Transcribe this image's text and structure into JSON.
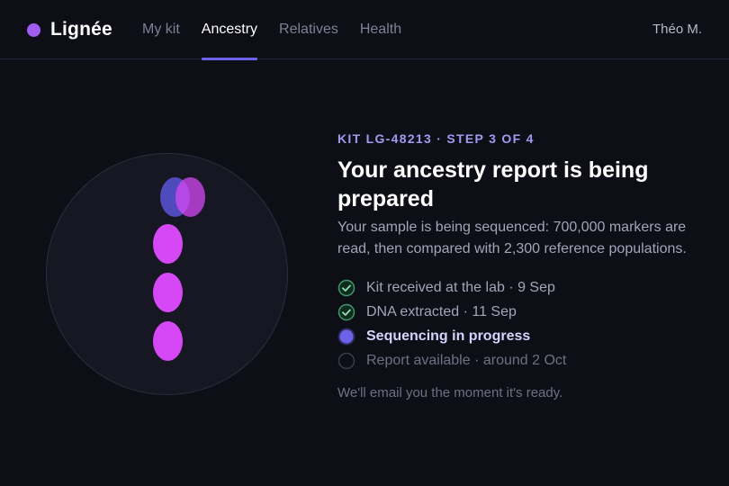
{
  "brand": {
    "name": "Lignée",
    "color": "#a15cf0"
  },
  "nav": {
    "tabs": [
      {
        "label": "My kit",
        "active": false
      },
      {
        "label": "Ancestry",
        "active": true
      },
      {
        "label": "Relatives",
        "active": false
      },
      {
        "label": "Health",
        "active": false
      }
    ],
    "user": "Théo M."
  },
  "status": {
    "eyebrow": "KIT LG-48213 · STEP 3 OF 4",
    "title": "Your ancestry report is being prepared",
    "description": "Your sample is being sequenced: 700,000 markers are read, then compared with 2,300 reference populations.",
    "steps": [
      {
        "label": "Kit received at the lab · 9 Sep",
        "state": "done",
        "icon": "check-circle-icon"
      },
      {
        "label": "DNA extracted · 11 Sep",
        "state": "done",
        "icon": "check-circle-icon"
      },
      {
        "label": "Sequencing in progress",
        "state": "current",
        "icon": "progress-dot-icon"
      },
      {
        "label": "Report available · around 2 Oct",
        "state": "pending",
        "icon": "empty-circle-icon"
      }
    ],
    "note": "We'll email you the moment it's ready."
  },
  "colors": {
    "accent": "#6c63e8",
    "magenta": "#d648f5",
    "blue": "#5a55d8",
    "done_green": "#3f9a68"
  }
}
